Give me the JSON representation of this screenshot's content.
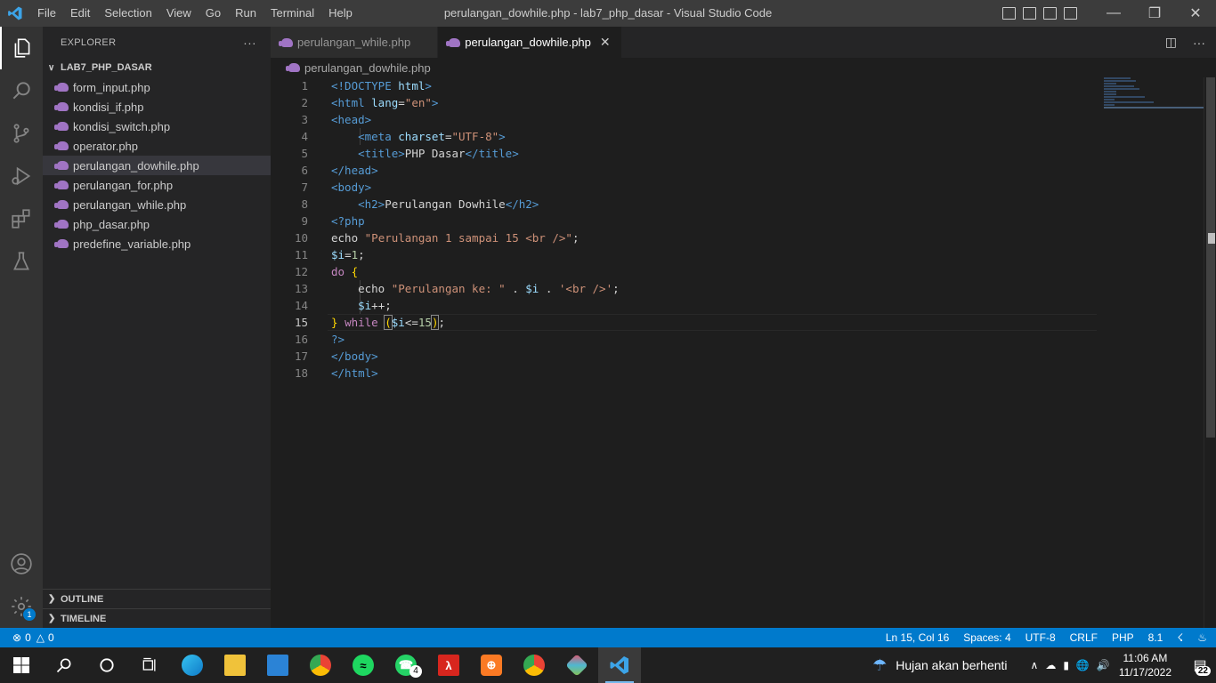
{
  "window": {
    "title": "perulangan_dowhile.php - lab7_php_dasar - Visual Studio Code",
    "menu": [
      "File",
      "Edit",
      "Selection",
      "View",
      "Go",
      "Run",
      "Terminal",
      "Help"
    ]
  },
  "sidebar": {
    "header": "EXPLORER",
    "more": "···",
    "folder": "LAB7_PHP_DASAR",
    "files": [
      "form_input.php",
      "kondisi_if.php",
      "kondisi_switch.php",
      "operator.php",
      "perulangan_dowhile.php",
      "perulangan_for.php",
      "perulangan_while.php",
      "php_dasar.php",
      "predefine_variable.php"
    ],
    "outline": "OUTLINE",
    "timeline": "TIMELINE"
  },
  "tabs": [
    {
      "label": "perulangan_while.php"
    },
    {
      "label": "perulangan_dowhile.php"
    }
  ],
  "breadcrumb": "perulangan_dowhile.php",
  "editor": {
    "current_line": 15,
    "line_numbers": [
      "1",
      "2",
      "3",
      "4",
      "5",
      "6",
      "7",
      "8",
      "9",
      "10",
      "11",
      "12",
      "13",
      "14",
      "15",
      "16",
      "17",
      "18"
    ]
  },
  "statusbar": {
    "errors": "0",
    "warnings": "0",
    "position": "Ln 15, Col 16",
    "spaces": "Spaces: 4",
    "encoding": "UTF-8",
    "eol": "CRLF",
    "language": "PHP",
    "version": "8.1",
    "settings_badge": "1"
  },
  "taskbar": {
    "whatsapp_badge": "4",
    "weather": "Hujan akan berhenti",
    "time": "11:06 AM",
    "date": "11/17/2022",
    "notifications": "22"
  },
  "colors": {
    "accent": "#007acc",
    "tag": "#569cd6",
    "attribute": "#9cdcfe",
    "string": "#ce9178",
    "keyword": "#c586c0",
    "number": "#b5cea8"
  }
}
